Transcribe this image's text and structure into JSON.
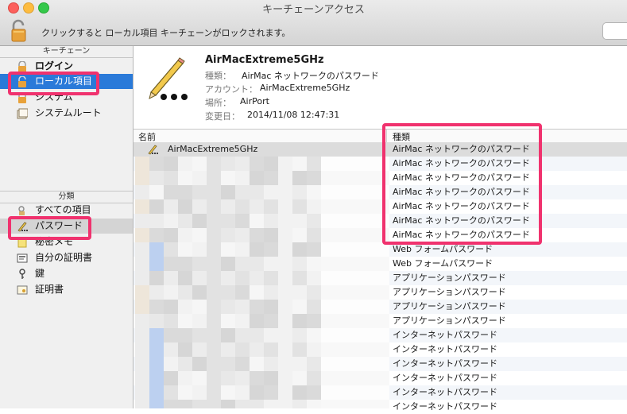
{
  "window": {
    "title": "キーチェーンアクセス",
    "lock_message": "クリックすると ローカル項目 キーチェーンがロックされます。"
  },
  "sidebar": {
    "keychain_header": "キーチェーン",
    "keychains": [
      {
        "label": "ログイン",
        "icon": "lock-icon"
      },
      {
        "label": "ローカル項目",
        "icon": "lock-icon"
      },
      {
        "label": "システム",
        "icon": "lock-icon"
      },
      {
        "label": "システムルート",
        "icon": "certificate-folder-icon"
      }
    ],
    "category_header": "分類",
    "categories": [
      {
        "label": "すべての項目",
        "icon": "all-items-icon"
      },
      {
        "label": "パスワード",
        "icon": "pencil-icon"
      },
      {
        "label": "秘密メモ",
        "icon": "note-icon"
      },
      {
        "label": "自分の証明書",
        "icon": "my-certificate-icon"
      },
      {
        "label": "鍵",
        "icon": "key-icon"
      },
      {
        "label": "証明書",
        "icon": "certificate-icon"
      }
    ]
  },
  "detail": {
    "name": "AirMacExtreme5GHz",
    "kind_label": "種類：",
    "kind_value": "AirMac ネットワークのパスワード",
    "account_label": "アカウント：",
    "account_value": "AirMacExtreme5GHz",
    "where_label": "場所：",
    "where_value": "AirPort",
    "modified_label": "変更日：",
    "modified_value": "2014/11/08 12:47:31"
  },
  "table": {
    "col_name": "名前",
    "col_kind": "種類",
    "rows": [
      {
        "name": "AirMacExtreme5GHz",
        "kind": "AirMac ネットワークのパスワード"
      },
      {
        "name": "",
        "kind": "AirMac ネットワークのパスワード"
      },
      {
        "name": "",
        "kind": "AirMac ネットワークのパスワード"
      },
      {
        "name": "",
        "kind": "AirMac ネットワークのパスワード"
      },
      {
        "name": "",
        "kind": "AirMac ネットワークのパスワード"
      },
      {
        "name": "",
        "kind": "AirMac ネットワークのパスワード"
      },
      {
        "name": "",
        "kind": "AirMac ネットワークのパスワード"
      },
      {
        "name": "",
        "kind": "Web フォームパスワード"
      },
      {
        "name": "",
        "kind": "Web フォームパスワード"
      },
      {
        "name": "",
        "kind": "アプリケーションパスワード"
      },
      {
        "name": "",
        "kind": "アプリケーションパスワード"
      },
      {
        "name": "",
        "kind": "アプリケーションパスワード"
      },
      {
        "name": "",
        "kind": "アプリケーションパスワード"
      },
      {
        "name": "",
        "kind": "インターネットパスワード"
      },
      {
        "name": "",
        "kind": "インターネットパスワード"
      },
      {
        "name": "",
        "kind": "インターネットパスワード"
      },
      {
        "name": "",
        "kind": "インターネットパスワード"
      },
      {
        "name": "",
        "kind": "インターネットパスワード"
      },
      {
        "name": "",
        "kind": "インターネットパスワード"
      }
    ]
  },
  "colors": {
    "selection": "#2a7ad9",
    "highlight": "#f0326e"
  }
}
